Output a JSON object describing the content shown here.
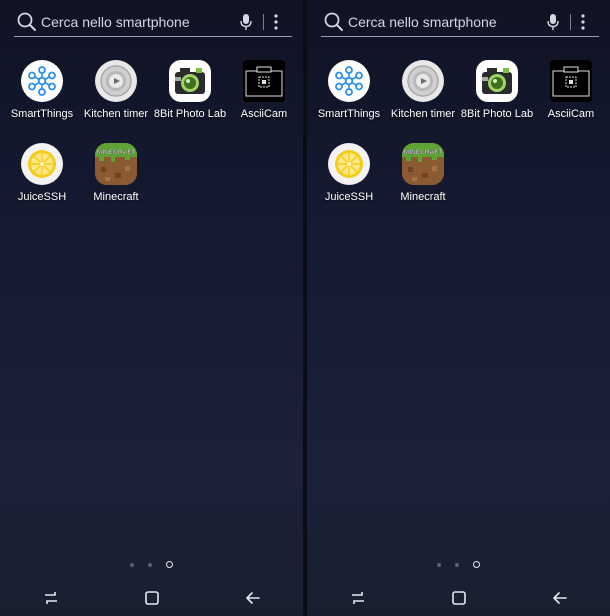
{
  "screens": [
    {
      "search": {
        "placeholder": "Cerca nello smartphone"
      },
      "apps": [
        {
          "label": "SmartThings",
          "icon": "smartthings-icon"
        },
        {
          "label": "Kitchen timer",
          "icon": "kitchen-timer-icon"
        },
        {
          "label": "8Bit Photo Lab",
          "icon": "8bit-photo-lab-icon"
        },
        {
          "label": "AsciiCam",
          "icon": "asciicam-icon"
        },
        {
          "label": "JuiceSSH",
          "icon": "juicessh-icon"
        },
        {
          "label": "Minecraft",
          "icon": "minecraft-icon"
        }
      ],
      "page_indicator": {
        "pages": 3,
        "current": 3
      }
    },
    {
      "search": {
        "placeholder": "Cerca nello smartphone"
      },
      "apps": [
        {
          "label": "SmartThings",
          "icon": "smartthings-icon"
        },
        {
          "label": "Kitchen timer",
          "icon": "kitchen-timer-icon"
        },
        {
          "label": "8Bit Photo Lab",
          "icon": "8bit-photo-lab-icon"
        },
        {
          "label": "AsciiCam",
          "icon": "asciicam-icon"
        },
        {
          "label": "JuiceSSH",
          "icon": "juicessh-icon"
        },
        {
          "label": "Minecraft",
          "icon": "minecraft-icon"
        }
      ],
      "page_indicator": {
        "pages": 3,
        "current": 3
      }
    }
  ],
  "icon_texts": {
    "minecraft": "MINECRAFT"
  },
  "navbar": [
    "recents-button",
    "home-button",
    "back-button"
  ],
  "colors": {
    "smartthings": "#2a8fe6",
    "juice_lemon": "#f5cc1a",
    "grass": "#5ea334",
    "dirt": "#8a5a32"
  }
}
